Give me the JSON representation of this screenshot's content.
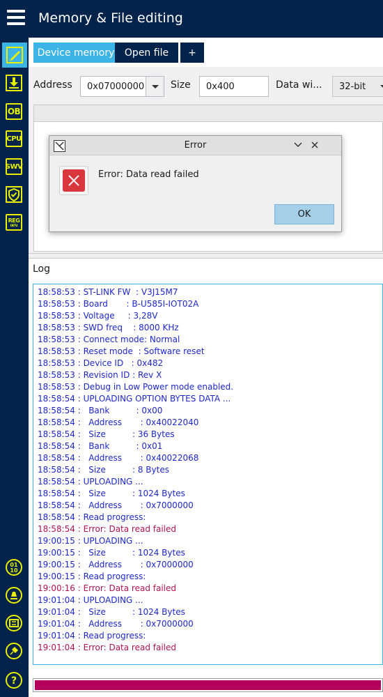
{
  "header": {
    "title": "Memory & File editing"
  },
  "rail": {
    "items": [
      {
        "icon": "edit-icon",
        "text": ""
      },
      {
        "icon": "download-icon",
        "text": ""
      },
      {
        "icon": "option-bytes-icon",
        "text": "OB"
      },
      {
        "icon": "cpu-icon",
        "text": "CPU"
      },
      {
        "icon": "swv-icon",
        "text": "SWV"
      },
      {
        "icon": "security-shield-icon",
        "text": ""
      },
      {
        "icon": "registers-icon",
        "text": "REG",
        "subtext": "DETV."
      },
      {
        "icon": "binary-icon",
        "text": ""
      },
      {
        "icon": "beta-icon",
        "text": ""
      },
      {
        "icon": "ecc-icon",
        "text": ""
      },
      {
        "icon": "plugin-icon",
        "text": ""
      },
      {
        "icon": "help-icon",
        "text": ""
      }
    ],
    "accent": "#3cb4e6",
    "icon_color": "#e8f000"
  },
  "tabs": [
    {
      "label": "Device memory",
      "active": true
    },
    {
      "label": "Open file",
      "active": false
    },
    {
      "label": "+",
      "active": false
    }
  ],
  "address_bar": {
    "address_label": "Address",
    "address_value": "0x07000000",
    "size_label": "Size",
    "size_value": "0x400",
    "data_width_label": "Data wi...",
    "data_width_value": "32-bit"
  },
  "log": {
    "title": "Log",
    "lines": [
      {
        "text": "18:58:53 : ST-LINK FW  : V3J15M7",
        "error": false
      },
      {
        "text": "18:58:53 : Board       : B-U585I-IOT02A",
        "error": false
      },
      {
        "text": "18:58:53 : Voltage     : 3,28V",
        "error": false
      },
      {
        "text": "18:58:53 : SWD freq    : 8000 KHz",
        "error": false
      },
      {
        "text": "18:58:53 : Connect mode: Normal",
        "error": false
      },
      {
        "text": "18:58:53 : Reset mode  : Software reset",
        "error": false
      },
      {
        "text": "18:58:53 : Device ID   : 0x482",
        "error": false
      },
      {
        "text": "18:58:53 : Revision ID : Rev X",
        "error": false
      },
      {
        "text": "18:58:53 : Debug in Low Power mode enabled.",
        "error": false
      },
      {
        "text": "18:58:54 : UPLOADING OPTION BYTES DATA ...",
        "error": false
      },
      {
        "text": "18:58:54 :   Bank          : 0x00",
        "error": false
      },
      {
        "text": "18:58:54 :   Address       : 0x40022040",
        "error": false
      },
      {
        "text": "18:58:54 :   Size          : 36 Bytes",
        "error": false
      },
      {
        "text": "18:58:54 :   Bank          : 0x01",
        "error": false
      },
      {
        "text": "18:58:54 :   Address       : 0x40022068",
        "error": false
      },
      {
        "text": "18:58:54 :   Size          : 8 Bytes",
        "error": false
      },
      {
        "text": "18:58:54 : UPLOADING ...",
        "error": false
      },
      {
        "text": "18:58:54 :   Size          : 1024 Bytes",
        "error": false
      },
      {
        "text": "18:58:54 :   Address       : 0x7000000",
        "error": false
      },
      {
        "text": "18:58:54 : Read progress:",
        "error": false
      },
      {
        "text": "18:58:54 : Error: Data read failed",
        "error": true
      },
      {
        "text": "19:00:15 : UPLOADING ...",
        "error": false
      },
      {
        "text": "19:00:15 :   Size          : 1024 Bytes",
        "error": false
      },
      {
        "text": "19:00:15 :   Address       : 0x7000000",
        "error": false
      },
      {
        "text": "19:00:15 : Read progress:",
        "error": false
      },
      {
        "text": "19:00:16 : Error: Data read failed",
        "error": true
      },
      {
        "text": "19:01:04 : UPLOADING ...",
        "error": false
      },
      {
        "text": "19:01:04 :   Size          : 1024 Bytes",
        "error": false
      },
      {
        "text": "19:01:04 :   Address       : 0x7000000",
        "error": false
      },
      {
        "text": "19:01:04 : Read progress:",
        "error": false
      },
      {
        "text": "19:01:04 : Error: Data read failed",
        "error": true
      }
    ],
    "info_color": "#1e28c8",
    "error_color": "#b01450"
  },
  "progress": {
    "fraction": 1.0,
    "color": "#b5005c"
  },
  "dialog": {
    "title": "Error",
    "message": "Error: Data read failed",
    "ok_label": "OK",
    "icon": "error-x-icon"
  }
}
